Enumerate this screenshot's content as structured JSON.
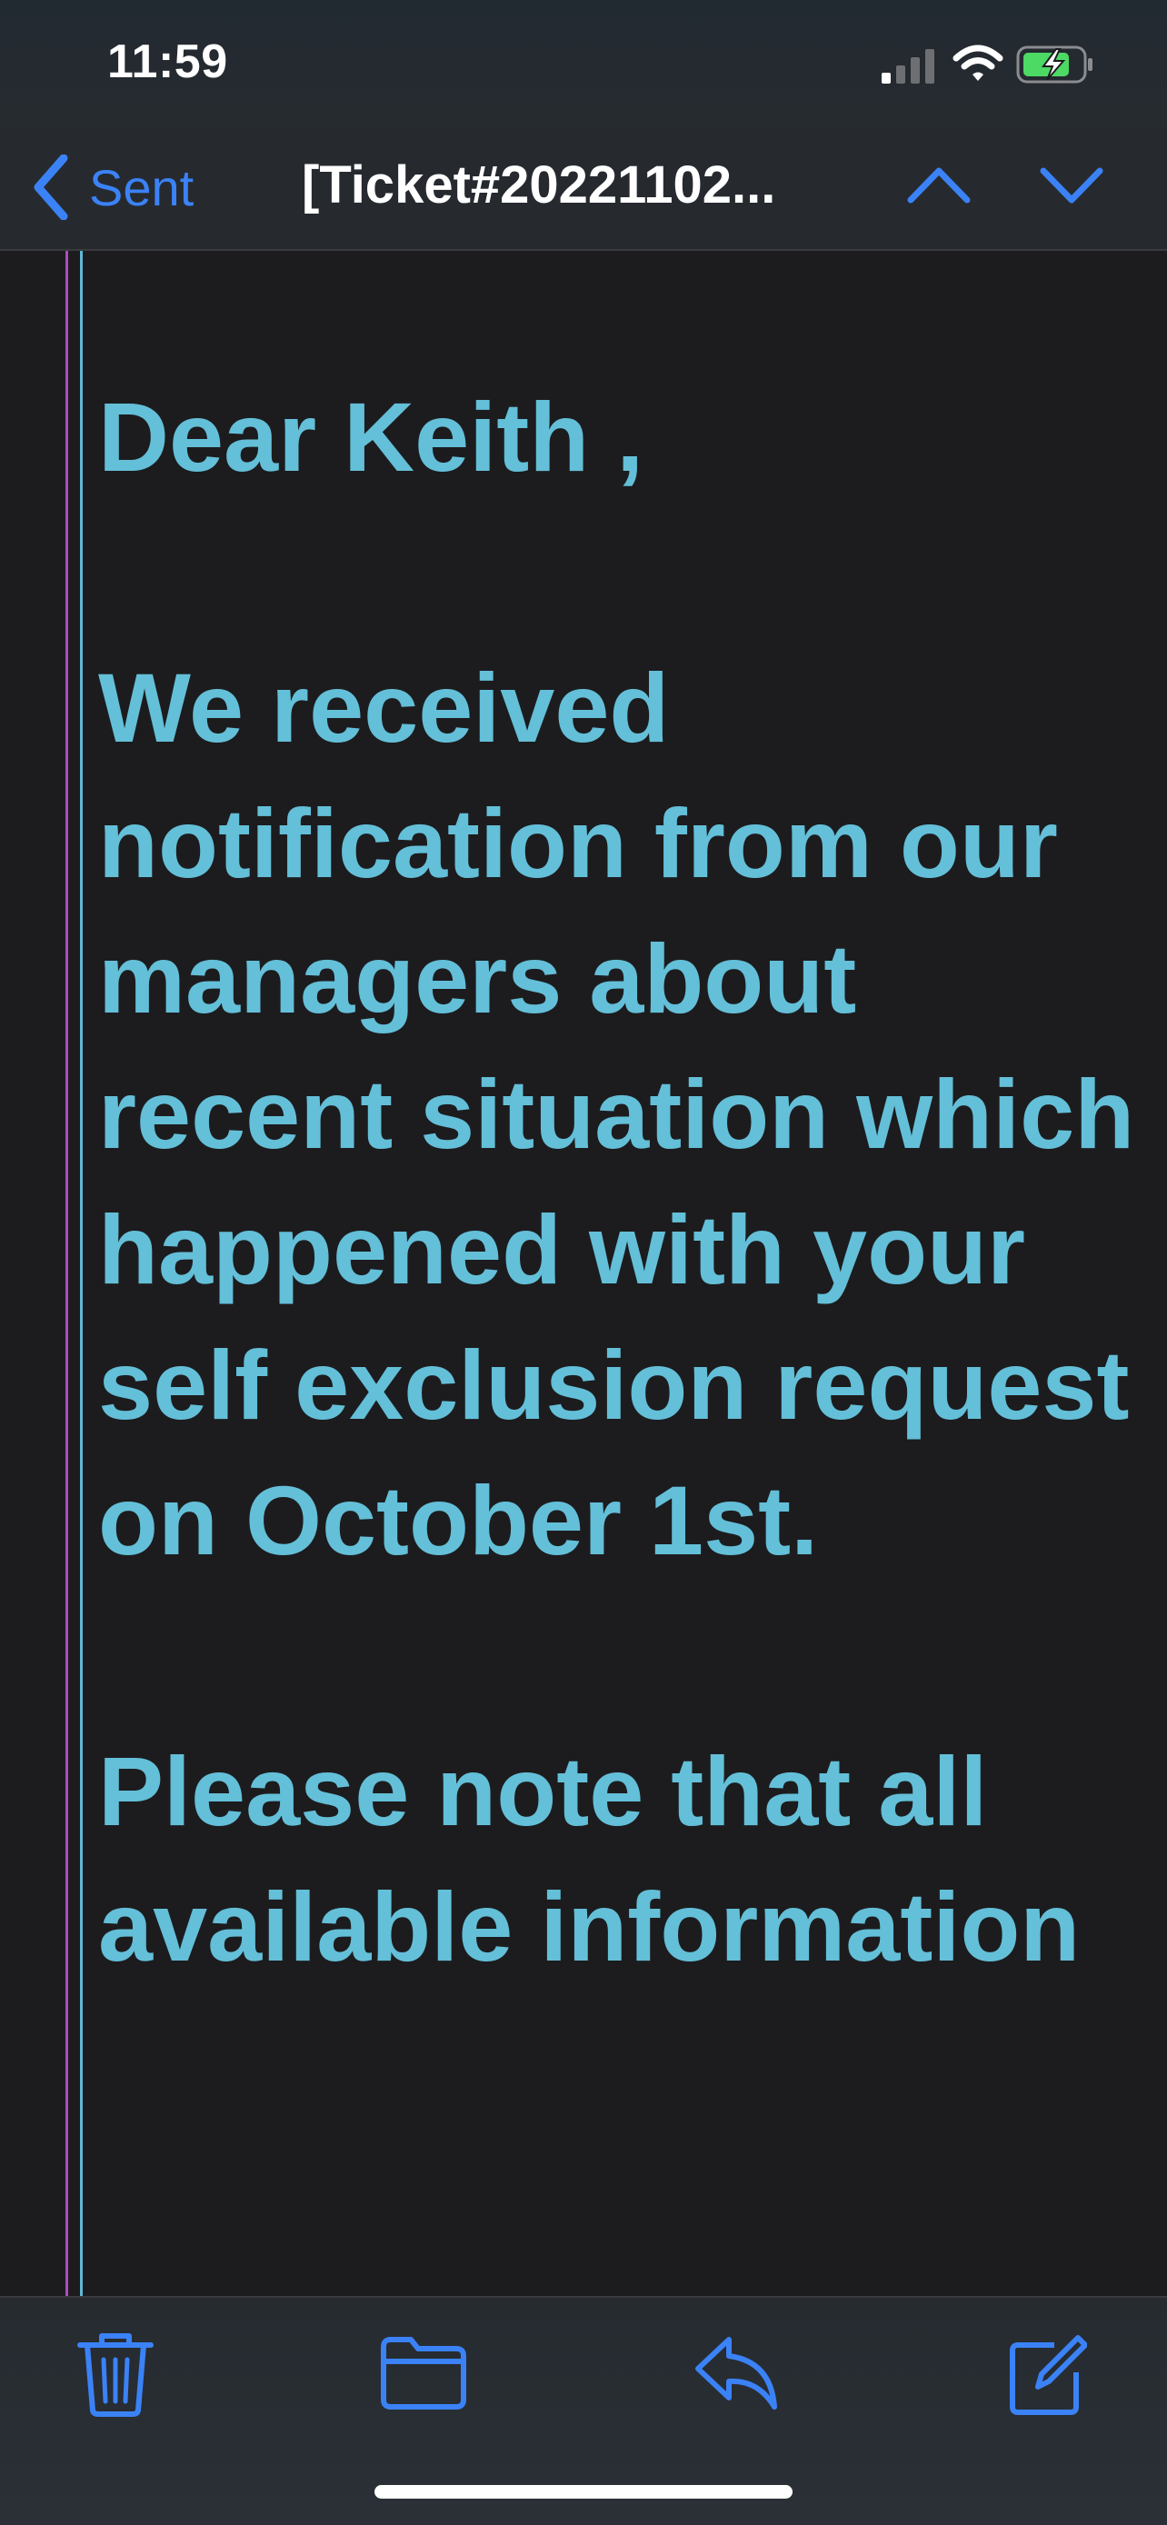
{
  "status_bar": {
    "time": "11:59",
    "signal_icon": "cellular-signal-icon",
    "wifi_icon": "wifi-icon",
    "battery_icon": "battery-charging-icon"
  },
  "nav": {
    "back_label": "Sent",
    "title": "[Ticket#20221102...",
    "prev_icon": "chevron-up-icon",
    "next_icon": "chevron-down-icon"
  },
  "message": {
    "greeting": "Dear Keith ,",
    "paragraph1": "We received notification from our managers about recent situation which happened with your self exclusion request on October 1st.",
    "paragraph2": "Please note that all available information"
  },
  "toolbar": {
    "trash_icon": "trash-icon",
    "folder_icon": "folder-icon",
    "reply_icon": "reply-icon",
    "compose_icon": "compose-icon"
  },
  "colors": {
    "accent": "#3b82f6",
    "message_text": "#64bfd8",
    "background": "#1c1c1e"
  }
}
